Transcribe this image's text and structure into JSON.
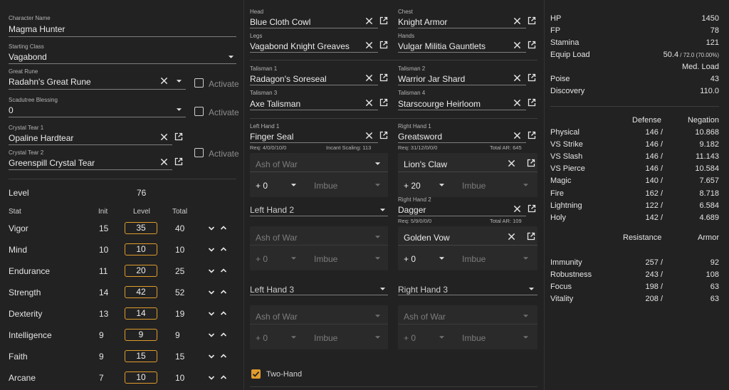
{
  "character": {
    "name_label": "Character Name",
    "name_value": "Magma Hunter",
    "class_label": "Starting Class",
    "class_value": "Vagabond",
    "rune_label": "Great Rune",
    "rune_value": "Radahn's Great Rune",
    "rune_activate": "Activate",
    "blessing_label": "Scadutree Blessing",
    "blessing_value": "0",
    "blessing_activate": "Activate",
    "tear1_label": "Crystal Tear 1",
    "tear1_value": "Opaline Hardtear",
    "tear2_label": "Crystal Tear 2",
    "tear2_value": "Greenspill Crystal Tear",
    "tear_activate": "Activate",
    "level_label": "Level",
    "level_value": "76"
  },
  "stats": {
    "headers": {
      "stat": "Stat",
      "init": "Init",
      "level": "Level",
      "total": "Total"
    },
    "rows": [
      {
        "name": "Vigor",
        "init": "15",
        "level": "35",
        "total": "40"
      },
      {
        "name": "Mind",
        "init": "10",
        "level": "10",
        "total": "10"
      },
      {
        "name": "Endurance",
        "init": "11",
        "level": "20",
        "total": "25"
      },
      {
        "name": "Strength",
        "init": "14",
        "level": "42",
        "total": "52"
      },
      {
        "name": "Dexterity",
        "init": "13",
        "level": "14",
        "total": "19"
      },
      {
        "name": "Intelligence",
        "init": "9",
        "level": "9",
        "total": "9"
      },
      {
        "name": "Faith",
        "init": "9",
        "level": "15",
        "total": "15"
      },
      {
        "name": "Arcane",
        "init": "7",
        "level": "10",
        "total": "10"
      }
    ]
  },
  "armor": {
    "head_label": "Head",
    "head_value": "Blue Cloth Cowl",
    "chest_label": "Chest",
    "chest_value": "Knight Armor",
    "legs_label": "Legs",
    "legs_value": "Vagabond Knight Greaves",
    "hands_label": "Hands",
    "hands_value": "Vulgar Militia Gauntlets"
  },
  "talismans": {
    "t1_label": "Talisman 1",
    "t1_value": "Radagon's Soreseal",
    "t2_label": "Talisman 2",
    "t2_value": "Warrior Jar Shard",
    "t3_label": "Talisman 3",
    "t3_value": "Axe Talisman",
    "t4_label": "Talisman 4",
    "t4_value": "Starscourge Heirloom"
  },
  "weapons": {
    "lh1_label": "Left Hand 1",
    "lh1_value": "Finger Seal",
    "lh1_req": "Req: 4/0/0/10/0",
    "lh1_scaling": "Incant Scaling: 113",
    "lh1_ash": "Ash of War",
    "lh1_upgrade": "+ 0",
    "lh1_imbue": "Imbue",
    "rh1_label": "Right Hand 1",
    "rh1_value": "Greatsword",
    "rh1_req": "Req: 31/12/0/0/0",
    "rh1_ar": "Total AR: 645",
    "rh1_ash": "Lion's Claw",
    "rh1_upgrade": "+ 20",
    "rh1_imbue": "Imbue",
    "lh2_value": "Left Hand 2",
    "lh2_ash": "Ash of War",
    "lh2_upgrade": "+ 0",
    "lh2_imbue": "Imbue",
    "rh2_label": "Right Hand 2",
    "rh2_value": "Dagger",
    "rh2_req": "Req: 5/9/0/0/0",
    "rh2_ar": "Total AR: 109",
    "rh2_ash": "Golden Vow",
    "rh2_upgrade": "+ 0",
    "rh2_imbue": "Imbue",
    "lh3_value": "Left Hand 3",
    "lh3_ash": "Ash of War",
    "lh3_upgrade": "+ 0",
    "lh3_imbue": "Imbue",
    "rh3_value": "Right Hand 3",
    "rh3_ash": "Ash of War",
    "rh3_upgrade": "+ 0",
    "rh3_imbue": "Imbue",
    "twohand_label": "Two-Hand"
  },
  "summary": {
    "hp_label": "HP",
    "hp_value": "1450",
    "fp_label": "FP",
    "fp_value": "78",
    "stamina_label": "Stamina",
    "stamina_value": "121",
    "equip_label": "Equip Load",
    "equip_value": "50.4",
    "equip_detail": " / 72.0 (70.00%)",
    "equip_class": "Med. Load",
    "poise_label": "Poise",
    "poise_value": "43",
    "discovery_label": "Discovery",
    "discovery_value": "110.0"
  },
  "defense": {
    "col_defense": "Defense",
    "col_negation": "Negation",
    "rows": [
      {
        "name": "Physical",
        "def": "146 /",
        "neg": "10.868"
      },
      {
        "name": "VS Strike",
        "def": "146 /",
        "neg": "9.182"
      },
      {
        "name": "VS Slash",
        "def": "146 /",
        "neg": "11.143"
      },
      {
        "name": "VS Pierce",
        "def": "146 /",
        "neg": "10.584"
      },
      {
        "name": "Magic",
        "def": "140 /",
        "neg": "7.657"
      },
      {
        "name": "Fire",
        "def": "162 /",
        "neg": "8.718"
      },
      {
        "name": "Lightning",
        "def": "122 /",
        "neg": "6.584"
      },
      {
        "name": "Holy",
        "def": "142 /",
        "neg": "4.689"
      }
    ]
  },
  "resistance": {
    "col_resistance": "Resistance",
    "col_armor": "Armor",
    "rows": [
      {
        "name": "Immunity",
        "res": "257 /",
        "armor": "92"
      },
      {
        "name": "Robustness",
        "res": "243 /",
        "armor": "108"
      },
      {
        "name": "Focus",
        "res": "198 /",
        "armor": "63"
      },
      {
        "name": "Vitality",
        "res": "208 /",
        "armor": "63"
      }
    ]
  },
  "icons": {
    "clear": "close-icon",
    "open": "open-in-new-icon",
    "dropdown": "triangle-down-icon",
    "increment": "chevron-up-icon",
    "decrement": "chevron-down-icon"
  },
  "colors": {
    "background": "#222222",
    "accent": "#e09c2c",
    "text": "#e8e8e8"
  }
}
